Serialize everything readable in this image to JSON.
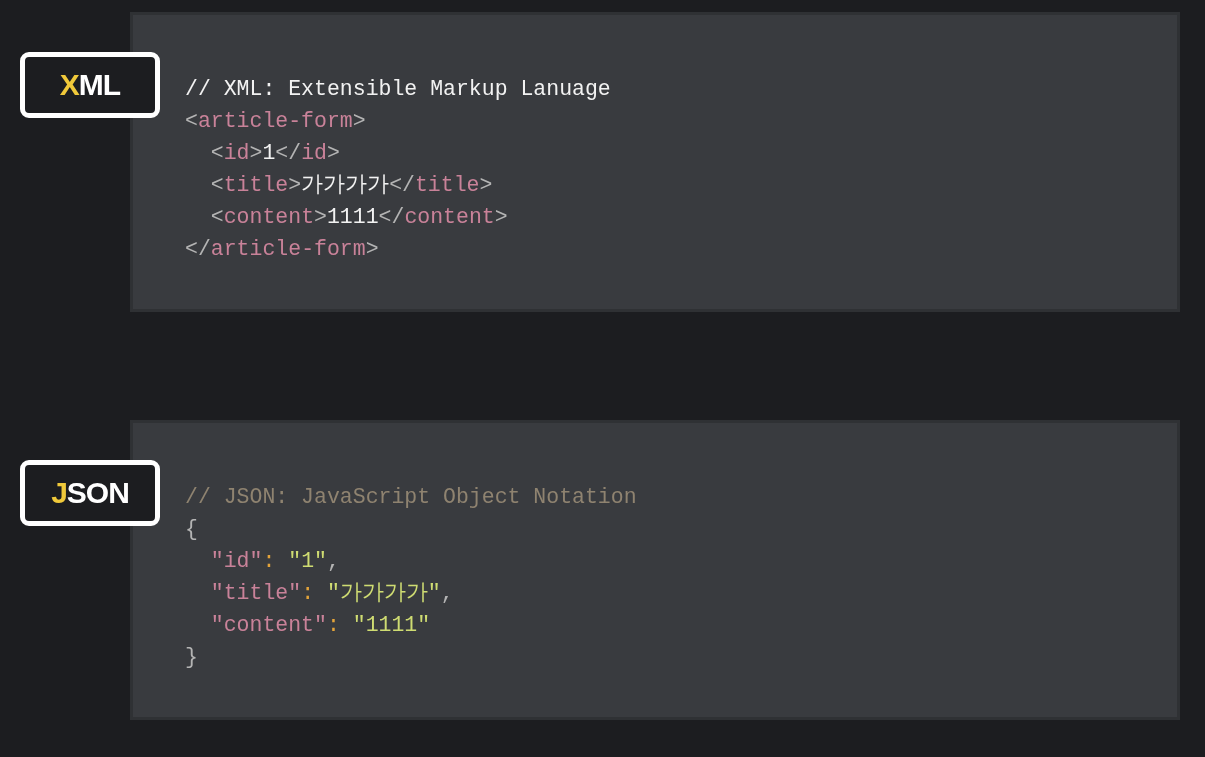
{
  "blocks": [
    {
      "label": {
        "accent": "X",
        "rest": "ML"
      },
      "lines": [
        [
          {
            "kind": "plain",
            "text": "// XML: Extensible Markup Lanuage"
          }
        ],
        [
          {
            "kind": "punct",
            "text": "<"
          },
          {
            "kind": "tag",
            "text": "article-form"
          },
          {
            "kind": "punct",
            "text": ">"
          }
        ],
        [
          {
            "kind": "punct",
            "text": "  <"
          },
          {
            "kind": "tag",
            "text": "id"
          },
          {
            "kind": "punct",
            "text": ">"
          },
          {
            "kind": "plain",
            "text": "1"
          },
          {
            "kind": "punct",
            "text": "</"
          },
          {
            "kind": "tag",
            "text": "id"
          },
          {
            "kind": "punct",
            "text": ">"
          }
        ],
        [
          {
            "kind": "punct",
            "text": "  <"
          },
          {
            "kind": "tag",
            "text": "title"
          },
          {
            "kind": "punct",
            "text": ">"
          },
          {
            "kind": "plain",
            "text": "가가가가"
          },
          {
            "kind": "punct",
            "text": "</"
          },
          {
            "kind": "tag",
            "text": "title"
          },
          {
            "kind": "punct",
            "text": ">"
          }
        ],
        [
          {
            "kind": "punct",
            "text": "  <"
          },
          {
            "kind": "tag",
            "text": "content"
          },
          {
            "kind": "punct",
            "text": ">"
          },
          {
            "kind": "plain",
            "text": "1111"
          },
          {
            "kind": "punct",
            "text": "</"
          },
          {
            "kind": "tag",
            "text": "content"
          },
          {
            "kind": "punct",
            "text": ">"
          }
        ],
        [
          {
            "kind": "punct",
            "text": "</"
          },
          {
            "kind": "tag",
            "text": "article-form"
          },
          {
            "kind": "punct",
            "text": ">"
          }
        ]
      ]
    },
    {
      "label": {
        "accent": "J",
        "rest": "SON"
      },
      "lines": [
        [
          {
            "kind": "comment",
            "text": "// JSON: JavaScript Object Notation"
          }
        ],
        [
          {
            "kind": "punct",
            "text": "{"
          }
        ],
        [
          {
            "kind": "tag",
            "text": "  \"id\""
          },
          {
            "kind": "colon",
            "text": ":"
          },
          {
            "kind": "string",
            "text": " \"1\""
          },
          {
            "kind": "punct",
            "text": ","
          }
        ],
        [
          {
            "kind": "tag",
            "text": "  \"title\""
          },
          {
            "kind": "colon",
            "text": ":"
          },
          {
            "kind": "string",
            "text": " \"가가가가\""
          },
          {
            "kind": "punct",
            "text": ","
          }
        ],
        [
          {
            "kind": "tag",
            "text": "  \"content\""
          },
          {
            "kind": "colon",
            "text": ":"
          },
          {
            "kind": "string",
            "text": " \"1111\""
          }
        ],
        [
          {
            "kind": "punct",
            "text": "}"
          }
        ]
      ]
    }
  ]
}
